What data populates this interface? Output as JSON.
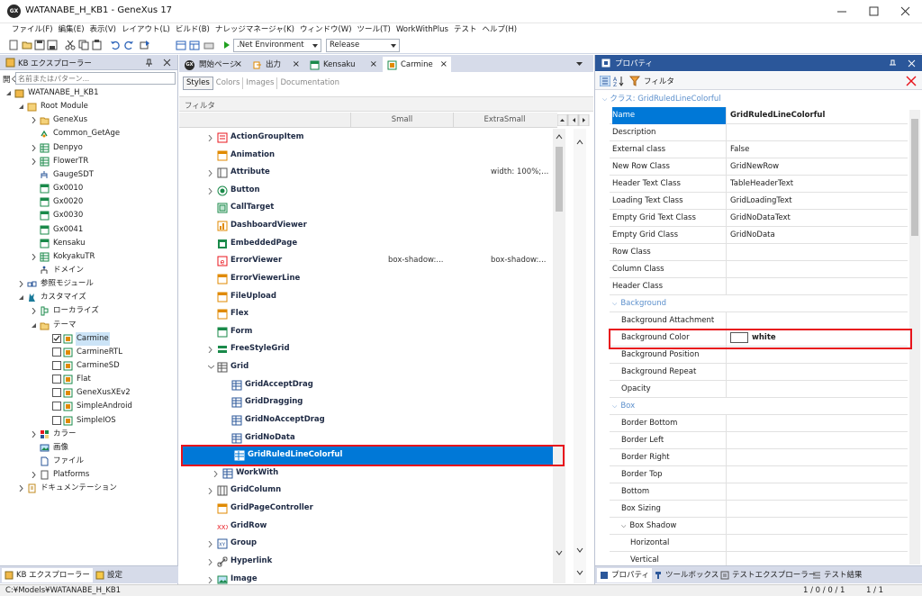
{
  "window": {
    "title": "WATANABE_H_KB1 - GeneXus 17",
    "logo": "GX"
  },
  "menu": [
    "ファイル(F)",
    "編集(E)",
    "表示(V)",
    "レイアウト(L)",
    "ビルド(B)",
    "ナレッジマネージャ(K)",
    "ウィンドウ(W)",
    "ツール(T)",
    "WorkWithPlus",
    "テスト",
    "ヘルプ(H)"
  ],
  "toolbar": {
    "environment": ".Net Environment",
    "configuration": "Release"
  },
  "kb_explorer": {
    "title": "KB エクスプローラー",
    "search_label": "開く:",
    "search_placeholder": "名前またはパターン...",
    "tree": [
      {
        "label": "WATANABE_H_KB1"
      },
      {
        "label": "Root Module"
      },
      {
        "label": "GeneXus"
      },
      {
        "label": "Common_GetAge"
      },
      {
        "label": "Denpyo"
      },
      {
        "label": "FlowerTR"
      },
      {
        "label": "GaugeSDT"
      },
      {
        "label": "Gx0010"
      },
      {
        "label": "Gx0020"
      },
      {
        "label": "Gx0030"
      },
      {
        "label": "Gx0041"
      },
      {
        "label": "Kensaku"
      },
      {
        "label": "KokyakuTR"
      },
      {
        "label": "ドメイン"
      },
      {
        "label": "参照モジュール"
      },
      {
        "label": "カスタマイズ"
      },
      {
        "label": "ローカライズ"
      },
      {
        "label": "テーマ"
      },
      {
        "label": "Carmine"
      },
      {
        "label": "CarmineRTL"
      },
      {
        "label": "CarmineSD"
      },
      {
        "label": "Flat"
      },
      {
        "label": "GeneXusXEv2"
      },
      {
        "label": "SimpleAndroid"
      },
      {
        "label": "SimpleIOS"
      },
      {
        "label": "カラー"
      },
      {
        "label": "画像"
      },
      {
        "label": "ファイル"
      },
      {
        "label": "Platforms"
      },
      {
        "label": "ドキュメンテーション"
      }
    ],
    "bottom_tabs": [
      "KB エクスプローラー",
      "設定"
    ]
  },
  "doc_tabs": [
    "開始ページ",
    "出力",
    "Kensaku",
    "Carmine"
  ],
  "theme_editor": {
    "subtabs": [
      "Styles",
      "Colors",
      "Images",
      "Documentation"
    ],
    "filter_label": "フィルタ",
    "columns": [
      "Small",
      "ExtraSmall"
    ],
    "rows": [
      {
        "name": "ActionGroupItem",
        "v1": "",
        "v2": ""
      },
      {
        "name": "Animation",
        "v1": "",
        "v2": ""
      },
      {
        "name": "Attribute",
        "v1": "",
        "v2": "width: 100%;..."
      },
      {
        "name": "Button",
        "v1": "",
        "v2": ""
      },
      {
        "name": "CallTarget",
        "v1": "",
        "v2": ""
      },
      {
        "name": "DashboardViewer",
        "v1": "",
        "v2": ""
      },
      {
        "name": "EmbeddedPage",
        "v1": "",
        "v2": ""
      },
      {
        "name": "ErrorViewer",
        "v1": "box-shadow:...",
        "v2": "box-shadow:..."
      },
      {
        "name": "ErrorViewerLine",
        "v1": "",
        "v2": ""
      },
      {
        "name": "FileUpload",
        "v1": "",
        "v2": ""
      },
      {
        "name": "Flex",
        "v1": "",
        "v2": ""
      },
      {
        "name": "Form",
        "v1": "",
        "v2": ""
      },
      {
        "name": "FreeStyleGrid",
        "v1": "",
        "v2": ""
      },
      {
        "name": "Grid",
        "v1": "",
        "v2": ""
      },
      {
        "name": "GridAcceptDrag",
        "v1": "",
        "v2": ""
      },
      {
        "name": "GridDragging",
        "v1": "",
        "v2": ""
      },
      {
        "name": "GridNoAcceptDrag",
        "v1": "",
        "v2": ""
      },
      {
        "name": "GridNoData",
        "v1": "",
        "v2": ""
      },
      {
        "name": "GridRuledLineColorful",
        "v1": "",
        "v2": ""
      },
      {
        "name": "WorkWith",
        "v1": "",
        "v2": ""
      },
      {
        "name": "GridColumn",
        "v1": "",
        "v2": ""
      },
      {
        "name": "GridPageController",
        "v1": "",
        "v2": ""
      },
      {
        "name": "GridRow",
        "v1": "",
        "v2": ""
      },
      {
        "name": "Group",
        "v1": "",
        "v2": ""
      },
      {
        "name": "Hyperlink",
        "v1": "",
        "v2": ""
      },
      {
        "name": "Image",
        "v1": "",
        "v2": ""
      }
    ]
  },
  "properties": {
    "title": "プロパティ",
    "filter_label": "フィルタ",
    "class_label": "クラス: GridRuledLineColorful",
    "rows": [
      {
        "name": "Name",
        "value": "GridRuledLineColorful"
      },
      {
        "name": "Description",
        "value": ""
      },
      {
        "name": "External class",
        "value": "False"
      },
      {
        "name": "New Row Class",
        "value": "GridNewRow"
      },
      {
        "name": "Header Text Class",
        "value": "TableHeaderText"
      },
      {
        "name": "Loading Text Class",
        "value": "GridLoadingText"
      },
      {
        "name": "Empty Grid Text Class",
        "value": "GridNoDataText"
      },
      {
        "name": "Empty Grid Class",
        "value": "GridNoData"
      },
      {
        "name": "Row Class",
        "value": ""
      },
      {
        "name": "Column Class",
        "value": ""
      },
      {
        "name": "Header Class",
        "value": ""
      }
    ],
    "cat_background": "Background",
    "background_rows": [
      {
        "name": "Background Attachment",
        "value": ""
      },
      {
        "name": "Background Color",
        "value": "white"
      },
      {
        "name": "Background Position",
        "value": ""
      },
      {
        "name": "Background Repeat",
        "value": ""
      },
      {
        "name": "Opacity",
        "value": ""
      }
    ],
    "cat_box": "Box",
    "box_rows": [
      {
        "name": "Border Bottom"
      },
      {
        "name": "Border Left"
      },
      {
        "name": "Border Right"
      },
      {
        "name": "Border Top"
      },
      {
        "name": "Bottom"
      },
      {
        "name": "Box Sizing"
      },
      {
        "name": "Box Shadow"
      },
      {
        "name": "Horizontal"
      },
      {
        "name": "Vertical"
      }
    ],
    "bottom_tabs": [
      "プロパティ",
      "ツールボックス",
      "テストエクスプローラー",
      "テスト結果"
    ]
  },
  "status": {
    "path": "C:¥Models¥WATANABE_H_KB1",
    "counts": "1 / 0 / 0 / 1",
    "pages": "1 / 1"
  },
  "colors": {
    "accent": "#0078d7",
    "highlight": "#e8141c",
    "panel": "#d6dbe9",
    "prop_header": "#2b579a"
  }
}
